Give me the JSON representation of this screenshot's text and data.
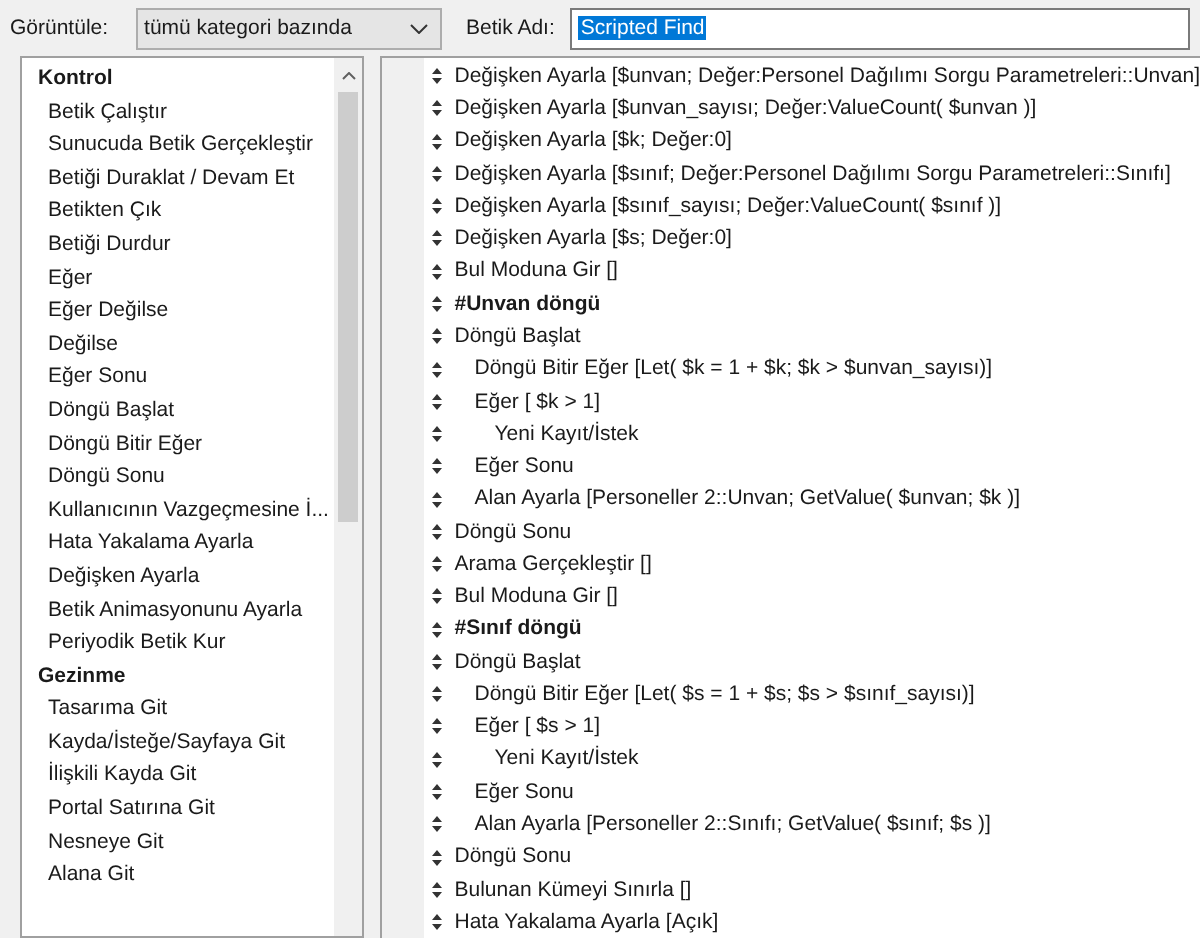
{
  "toolbar": {
    "view_label": "Görüntüle:",
    "view_value": "tümü kategori bazında",
    "name_label": "Betik Adı:",
    "name_value": "Scripted Find",
    "name_text_selected": true
  },
  "step_list": [
    {
      "category": "Kontrol",
      "items": [
        "Betik Çalıştır",
        "Sunucuda Betik Gerçekleştir",
        "Betiği Duraklat / Devam Et",
        "Betikten Çık",
        "Betiği Durdur",
        "Eğer",
        "Eğer Değilse",
        "Değilse",
        "Eğer Sonu",
        "Döngü Başlat",
        "Döngü Bitir Eğer",
        "Döngü Sonu",
        "Kullanıcının Vazgeçmesine İ...",
        "Hata Yakalama Ayarla",
        "Değişken Ayarla",
        "Betik Animasyonunu Ayarla",
        "Periyodik Betik Kur"
      ]
    },
    {
      "category": "Gezinme",
      "items": [
        "Tasarıma Git",
        "Kayda/İsteğe/Sayfaya Git",
        "İlişkili Kayda Git",
        "Portal Satırına Git",
        "Nesneye Git",
        "Alana Git"
      ]
    }
  ],
  "script_steps": [
    {
      "kind": "step",
      "text": "Değişken Ayarla [$unvan; Değer:Personel Dağılımı Sorgu Parametreleri::Unvan]"
    },
    {
      "kind": "step",
      "text": "Değişken Ayarla [$unvan_sayısı; Değer:ValueCount( $unvan )]"
    },
    {
      "kind": "step",
      "text": "Değişken Ayarla [$k; Değer:0]"
    },
    {
      "kind": "step",
      "text": "Değişken Ayarla [$sınıf; Değer:Personel Dağılımı Sorgu Parametreleri::Sınıfı]"
    },
    {
      "kind": "step",
      "text": "Değişken Ayarla [$sınıf_sayısı; Değer:ValueCount( $sınıf )]"
    },
    {
      "kind": "step",
      "text": "Değişken Ayarla [$s; Değer:0]"
    },
    {
      "kind": "step",
      "text": "Bul Moduna Gir []"
    },
    {
      "kind": "comment",
      "text": "#Unvan döngü"
    },
    {
      "kind": "step",
      "text": "Döngü Başlat",
      "children": [
        {
          "kind": "step",
          "text": "Döngü Bitir Eğer [Let( $k = 1 + $k; $k > $unvan_sayısı)]"
        },
        {
          "kind": "step",
          "text": "Eğer [ $k > 1]",
          "children": [
            {
              "kind": "step",
              "text": "Yeni Kayıt/İstek"
            }
          ]
        },
        {
          "kind": "step",
          "text": "Eğer Sonu"
        },
        {
          "kind": "step",
          "text": "Alan Ayarla [Personeller 2::Unvan; GetValue( $unvan; $k )]"
        }
      ]
    },
    {
      "kind": "step",
      "text": "Döngü Sonu"
    },
    {
      "kind": "step",
      "text": "Arama Gerçekleştir []"
    },
    {
      "kind": "step",
      "text": "Bul Moduna Gir []"
    },
    {
      "kind": "comment",
      "text": "#Sınıf döngü"
    },
    {
      "kind": "step",
      "text": "Döngü Başlat",
      "children": [
        {
          "kind": "step",
          "text": "Döngü Bitir Eğer [Let( $s = 1 + $s; $s > $sınıf_sayısı)]"
        },
        {
          "kind": "step",
          "text": "Eğer [ $s > 1]",
          "children": [
            {
              "kind": "step",
              "text": "Yeni Kayıt/İstek"
            }
          ]
        },
        {
          "kind": "step",
          "text": "Eğer Sonu"
        },
        {
          "kind": "step",
          "text": "Alan Ayarla [Personeller 2::Sınıfı; GetValue( $sınıf; $s )]"
        }
      ]
    },
    {
      "kind": "step",
      "text": "Döngü Sonu"
    },
    {
      "kind": "step",
      "text": "Bulunan Kümeyi Sınırla []"
    },
    {
      "kind": "step",
      "text": "Hata Yakalama Ayarla [Açık]"
    }
  ]
}
